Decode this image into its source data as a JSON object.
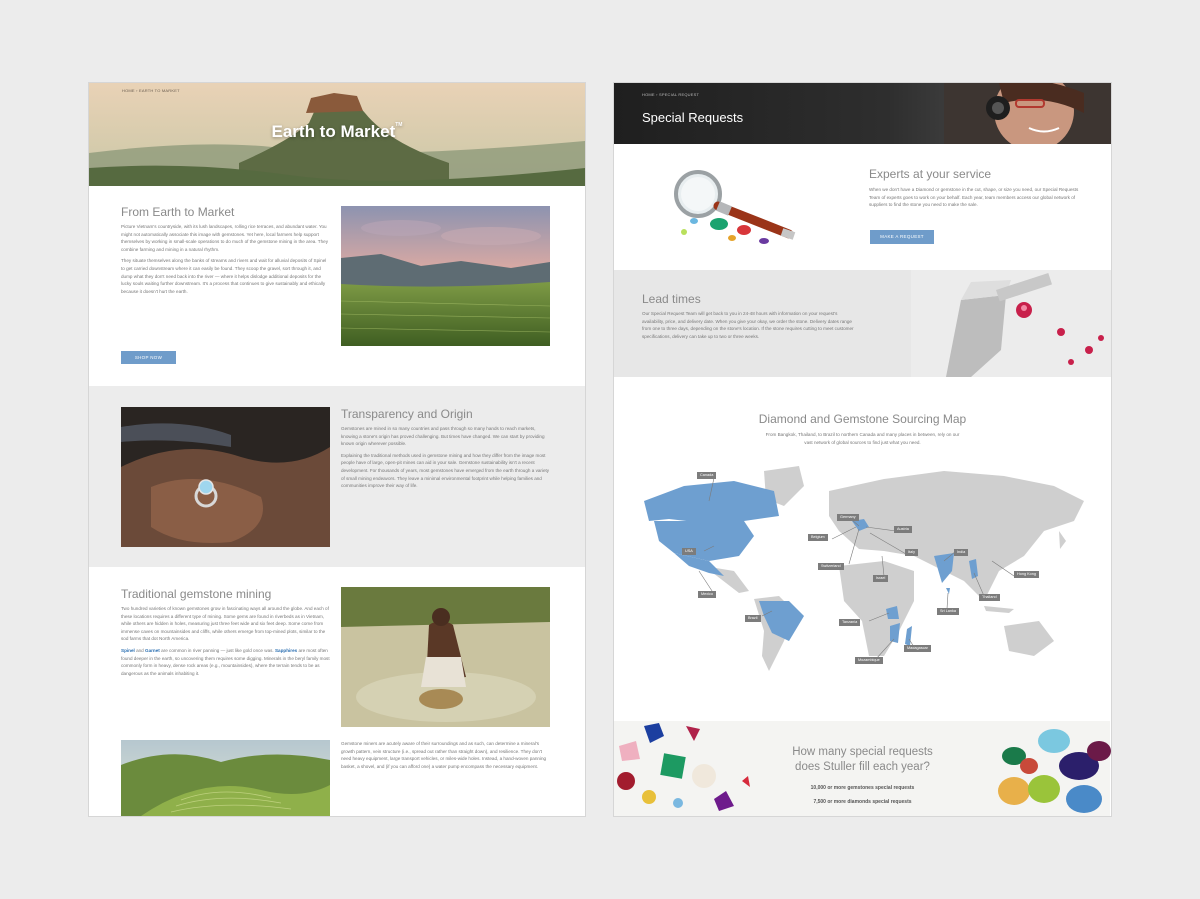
{
  "left": {
    "breadcrumb": "HOME  ›  EARTH TO MARKET",
    "hero_title": "Earth to Market",
    "hero_tm": "TM",
    "s1": {
      "title": "From Earth to Market",
      "p1": "Picture Vietnam's countryside, with its lush landscapes, rolling rice terraces, and abundant water. You might not automatically associate this image with gemstones. Yet here, local farmers help support themselves by working in small-scale operations to do much of the gemstone mining in the area. They combine farming and mining in a natural rhythm.",
      "p2": "They situate themselves along the banks of streams and rivers and wait for alluvial deposits of Spinel to get carried downstream where it can easily be found. They scoop the gravel, sort through it, and dump what they don't need back into the river — where it helps dislodge additional deposits for the lucky souls waiting further downstream. It's a process that continues to give sustainably and ethically because it doesn't hurt the earth.",
      "button": "SHOP NOW"
    },
    "s2": {
      "title": "Transparency and Origin",
      "p1": "Gemstones are mined in so many countries and pass through so many hands to reach markets, knowing a stone's origin has proved challenging. But times have changed. We can start by providing known origin wherever possible.",
      "p2": "Explaining the traditional methods used in gemstone mining and how they differ from the image most people have of large, open-pit mines can aid in your sale. Gemstone sustainability isn't a recent development. For thousands of years, most gemstones have emerged from the earth through a variety of small mining endeavors. They leave a minimal environmental footprint while helping families and communities improve their way of life."
    },
    "s3": {
      "title": "Traditional gemstone mining",
      "p1": "Two hundred varieties of known gemstones grow in fascinating ways all around the globe. And each of these locations requires a different type of mining. Some gems are found in riverbeds as in Vietnam, while others are hidden in holes, measuring just three feet wide and six feet deep. Some come from immense caves on mountainsides and cliffs, while others emerge from top-mined plots, similar to the sod farms that dot North America.",
      "link1": "Spinel",
      "and": " and ",
      "link2": "Garnet",
      "p2_mid": " are common in river panning — just like gold once was. ",
      "link3": "Sapphires",
      "p2_end": " are most often found deeper in the earth, so uncovering them requires some digging. Minerals in the beryl family most commonly form in heavy, dense rock areas (e.g., mountainsides), where the terrain tends to be as dangerous as the animals inhabiting it.",
      "p3": "Gemstone miners are acutely aware of their surroundings and as such, can determine a mineral's growth pattern, vein structure (i.e., spread out rather than straight down), and resilience. They don't need heavy equipment, large transport vehicles, or miles-wide holes. Instead, a hand-woven panning basket, a shovel, and (if you can afford one) a water pump encompass the necessary equipment."
    }
  },
  "right": {
    "breadcrumb": "HOME  ›  SPECIAL REQUEST",
    "hero_title": "Special Requests",
    "experts": {
      "title": "Experts at your service",
      "body": "When we don't have a Diamond or gemstone in the cut, shape, or size you need, our Special Requests Team of experts goes to work on your behalf. Each year, team members access our global network of suppliers to find the stone you need to make the sale.",
      "button": "MAKE A REQUEST"
    },
    "lead": {
      "title": "Lead times",
      "body": "Our Special Request Team will get back to you in 24-48 hours with information on your request's availability, price, and delivery date. When you give your okay, we order the stone. Delivery dates range from one to three days, depending on the stone's location.  If the stone requires cutting to meet customer specifications, delivery can take up to two or three weeks."
    },
    "map": {
      "title": "Diamond and Gemstone Sourcing Map",
      "subtitle": "From Bangkok, Thailand, to Brazil to northern Canada and many places in between, rely on our vast network of global sources to find just what you need.",
      "labels": [
        "Canada",
        "USA",
        "Mexico",
        "Brazil",
        "Germany",
        "Belgium",
        "Austria",
        "Switzerland",
        "Italy",
        "Israel",
        "India",
        "Hong Kong",
        "Thailand",
        "Sri Lanka",
        "Tanzania",
        "Mozambique",
        "Madagascar"
      ],
      "highlight_color": "#6e9fd0",
      "land_color": "#cfcfcf"
    },
    "stats": {
      "question_line1": "How many special requests",
      "question_line2": "does Stuller fill each year?",
      "line1": "10,000 or more gemstones special requests",
      "line2": "7,500 or more diamonds special requests"
    }
  }
}
